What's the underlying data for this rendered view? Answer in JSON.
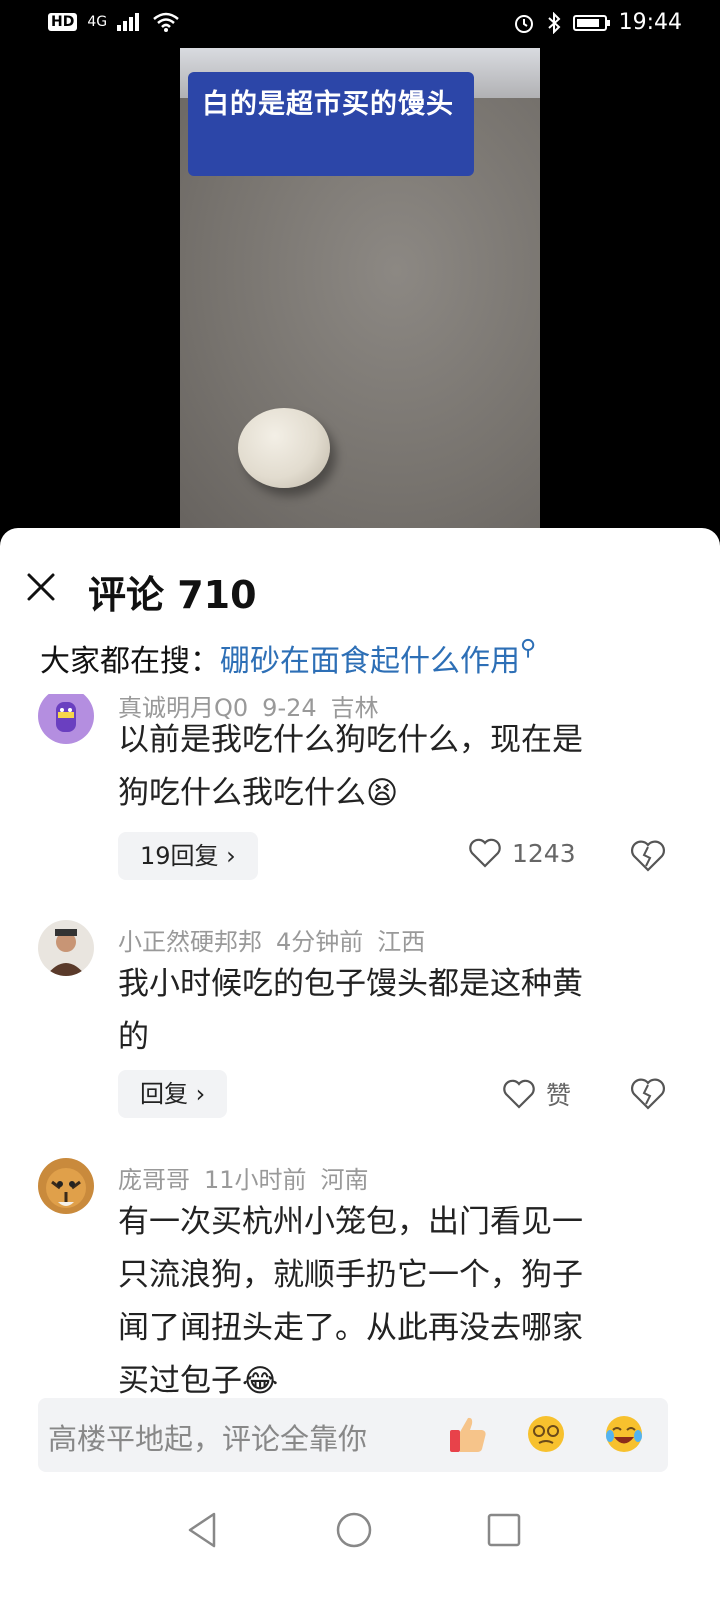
{
  "status": {
    "time": "19:44",
    "network": "4G",
    "hd": "HD"
  },
  "video": {
    "caption": "白的是超市买的馒头"
  },
  "panel": {
    "title": "评论 710",
    "trending_prefix": "大家都在搜：",
    "trending_link": "硼砂在面食起什么作用"
  },
  "comments": [
    {
      "user": "真诚明月Q0",
      "time": "9-24",
      "location": "吉林",
      "lines": [
        "以前是我吃什么狗吃什么，现在是",
        "狗吃什么我吃什么😫"
      ],
      "reply_label": "19回复 ›",
      "likes": "1243"
    },
    {
      "user": "小正然硬邦邦",
      "time": "4分钟前",
      "location": "江西",
      "lines": [
        "我小时候吃的包子馒头都是这种黄",
        "的"
      ],
      "reply_label": "回复 ›",
      "likes": "赞"
    },
    {
      "user": "庞哥哥",
      "time": "11小时前",
      "location": "河南",
      "lines": [
        "有一次买杭州小笼包，出门看见一",
        "只流浪狗，就顺手扔它一个，狗子",
        "闻了闻扭头走了。从此再没去哪家",
        "买过包子😂"
      ]
    }
  ],
  "input": {
    "placeholder": "高楼平地起，评论全靠你"
  },
  "colors": {
    "link": "#2d6fb6",
    "caption_bg": "#2c46a8"
  },
  "icons": [
    "close-icon",
    "search-icon",
    "heart-icon",
    "broken-heart-icon",
    "thumbs-up-emoji",
    "emoji-face",
    "laughing-emoji",
    "back-icon",
    "home-icon",
    "recents-icon"
  ]
}
